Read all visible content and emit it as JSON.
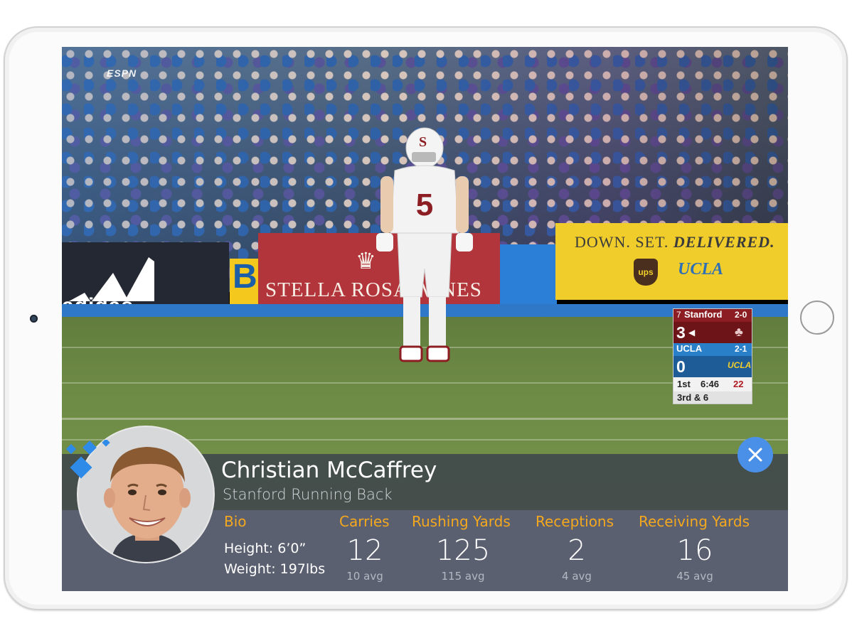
{
  "broadcast": {
    "network": "ESPN",
    "ads": {
      "adidas": "adidas",
      "yellow_letter": "B",
      "stella": "STELLA ROSA WINES",
      "slogan_light": "DOWN. SET.",
      "slogan_bold": "DELIVERED.",
      "ups": "ups",
      "ucla": "UCLA"
    },
    "player_number": "5"
  },
  "scorebug": {
    "away": {
      "rank": "7",
      "name": "Stanford",
      "record": "2-0",
      "score": "3"
    },
    "home": {
      "name": "UCLA",
      "record": "2-1",
      "score": "0"
    },
    "quarter": "1st",
    "clock": "6:46",
    "play_clock": "22",
    "down_distance": "3rd & 6"
  },
  "player_card": {
    "name": "Christian McCaffrey",
    "subtitle": "Stanford Running Back",
    "bio": {
      "label": "Bio",
      "height": "Height: 6’0”",
      "weight": "Weight: 197lbs"
    },
    "stats": [
      {
        "label": "Carries",
        "value": "12",
        "avg": "10 avg"
      },
      {
        "label": "Rushing Yards",
        "value": "125",
        "avg": "115 avg"
      },
      {
        "label": "Receptions",
        "value": "2",
        "avg": "4 avg"
      },
      {
        "label": "Receiving Yards",
        "value": "16",
        "avg": "45 avg"
      }
    ]
  },
  "colors": {
    "accent_orange": "#f4a81e",
    "close_blue": "#4a90e8",
    "stanford_red": "#8c1d22",
    "ucla_blue": "#2a7fc9"
  },
  "icons": [
    "close-icon",
    "brand-mark-icon",
    "player-avatar"
  ]
}
